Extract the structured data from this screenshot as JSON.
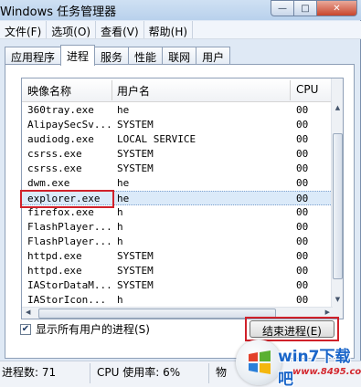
{
  "window": {
    "title": "Windows 任务管理器",
    "controls": {
      "minimize": "—",
      "maximize": "□",
      "close": "✕"
    }
  },
  "menu": [
    "文件(F)",
    "选项(O)",
    "查看(V)",
    "帮助(H)"
  ],
  "tabs": [
    "应用程序",
    "进程",
    "服务",
    "性能",
    "联网",
    "用户"
  ],
  "active_tab": "进程",
  "columns": {
    "name": "映像名称",
    "user": "用户名",
    "cpu": "CPU"
  },
  "processes": [
    {
      "name": "360tray.exe",
      "user": "he",
      "cpu": "00"
    },
    {
      "name": "AlipaySecSv...",
      "user": "SYSTEM",
      "cpu": "00"
    },
    {
      "name": "audiodg.exe",
      "user": "LOCAL SERVICE",
      "cpu": "00"
    },
    {
      "name": "csrss.exe",
      "user": "SYSTEM",
      "cpu": "00"
    },
    {
      "name": "csrss.exe",
      "user": "SYSTEM",
      "cpu": "00"
    },
    {
      "name": "dwm.exe",
      "user": "he",
      "cpu": "00"
    },
    {
      "name": "explorer.exe",
      "user": "he",
      "cpu": "00"
    },
    {
      "name": "firefox.exe",
      "user": "h",
      "cpu": "00"
    },
    {
      "name": "FlashPlayer...",
      "user": "h",
      "cpu": "00"
    },
    {
      "name": "FlashPlayer...",
      "user": "h",
      "cpu": "00"
    },
    {
      "name": "httpd.exe",
      "user": "SYSTEM",
      "cpu": "00"
    },
    {
      "name": "httpd.exe",
      "user": "SYSTEM",
      "cpu": "00"
    },
    {
      "name": "IAStorDataM...",
      "user": "SYSTEM",
      "cpu": "00"
    },
    {
      "name": "IAStorIcon...",
      "user": "h",
      "cpu": "00"
    }
  ],
  "selected_process": "explorer.exe",
  "show_all_users": {
    "label": "显示所有用户的进程(S)",
    "checked": true,
    "checkmark": "✔"
  },
  "end_process_button": "结束进程(E)",
  "status": {
    "processes": "进程数: 71",
    "cpu": "CPU 使用率: 6%",
    "memory": "物"
  },
  "scroll_arrows": {
    "up": "▲",
    "down": "▼",
    "left": "◀",
    "right": "▶"
  },
  "watermark": {
    "text": "win7下载吧",
    "url": "www.8495.com"
  },
  "colors": {
    "highlight_box": "#d0212a",
    "selection": "#dbeaf9",
    "watermark_blue": "#1b66c9"
  }
}
